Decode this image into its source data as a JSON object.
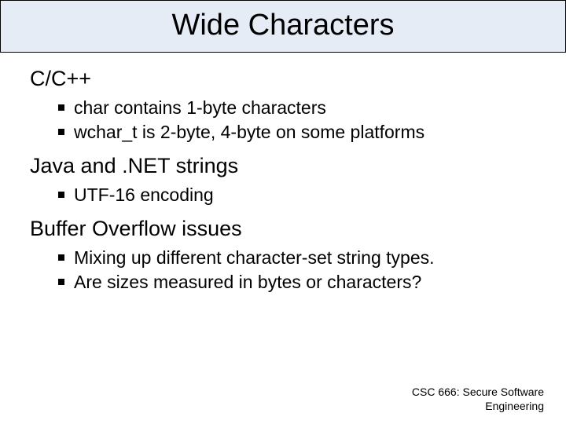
{
  "title": "Wide Characters",
  "sections": [
    {
      "heading": "C/C++",
      "bullets": [
        "char contains 1-byte characters",
        "wchar_t is 2-byte, 4-byte on some platforms"
      ]
    },
    {
      "heading": "Java and .NET strings",
      "bullets": [
        "UTF-16 encoding"
      ]
    },
    {
      "heading": "Buffer Overflow issues",
      "bullets": [
        "Mixing up different character-set string types.",
        "Are sizes measured in bytes or characters?"
      ]
    }
  ],
  "footer": {
    "line1": "CSC 666: Secure Software",
    "line2": "Engineering"
  }
}
